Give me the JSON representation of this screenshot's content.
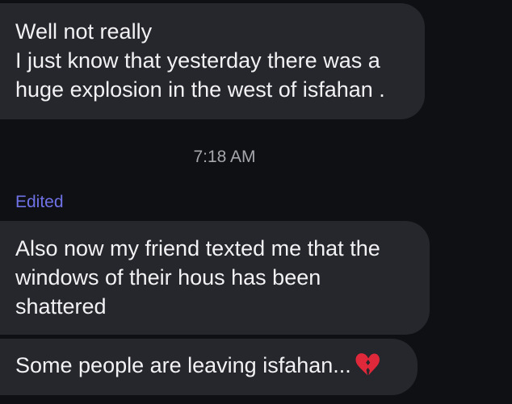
{
  "messages": [
    {
      "lines": [
        "Well not really",
        "I just know that yesterday there was a",
        "huge explosion in the west of isfahan ."
      ]
    },
    {
      "timestamp": "7:18 AM",
      "edited_label": "Edited",
      "lines": [
        "Also now my friend texted me that the",
        "windows of their hous has been",
        "shattered"
      ]
    },
    {
      "text": "Some people are leaving isfahan...",
      "emoji": "broken-heart-icon"
    }
  ],
  "colors": {
    "background": "#0f1014",
    "bubble": "#26272c",
    "text": "#f2f2f4",
    "timestamp": "#a6a7ad",
    "edited": "#6f72e6",
    "emoji": "#e0283b"
  }
}
